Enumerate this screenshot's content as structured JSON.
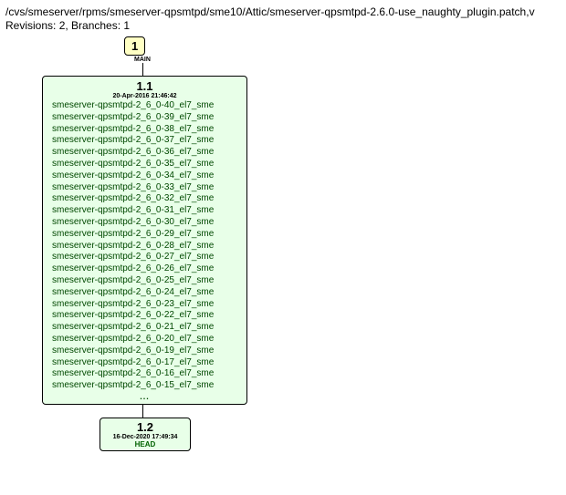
{
  "header": {
    "path": "/cvs/smeserver/rpms/smeserver-qpsmtpd/sme10/Attic/smeserver-qpsmtpd-2.6.0-use_naughty_plugin.patch,v",
    "revisions_line": "Revisions: 2, Branches: 1"
  },
  "branch_box": {
    "number": "1",
    "label": "MAIN"
  },
  "revision1": {
    "number": "1.1",
    "date": "20-Apr-2016 21:46:42",
    "tags": [
      "smeserver-qpsmtpd-2_6_0-40_el7_sme",
      "smeserver-qpsmtpd-2_6_0-39_el7_sme",
      "smeserver-qpsmtpd-2_6_0-38_el7_sme",
      "smeserver-qpsmtpd-2_6_0-37_el7_sme",
      "smeserver-qpsmtpd-2_6_0-36_el7_sme",
      "smeserver-qpsmtpd-2_6_0-35_el7_sme",
      "smeserver-qpsmtpd-2_6_0-34_el7_sme",
      "smeserver-qpsmtpd-2_6_0-33_el7_sme",
      "smeserver-qpsmtpd-2_6_0-32_el7_sme",
      "smeserver-qpsmtpd-2_6_0-31_el7_sme",
      "smeserver-qpsmtpd-2_6_0-30_el7_sme",
      "smeserver-qpsmtpd-2_6_0-29_el7_sme",
      "smeserver-qpsmtpd-2_6_0-28_el7_sme",
      "smeserver-qpsmtpd-2_6_0-27_el7_sme",
      "smeserver-qpsmtpd-2_6_0-26_el7_sme",
      "smeserver-qpsmtpd-2_6_0-25_el7_sme",
      "smeserver-qpsmtpd-2_6_0-24_el7_sme",
      "smeserver-qpsmtpd-2_6_0-23_el7_sme",
      "smeserver-qpsmtpd-2_6_0-22_el7_sme",
      "smeserver-qpsmtpd-2_6_0-21_el7_sme",
      "smeserver-qpsmtpd-2_6_0-20_el7_sme",
      "smeserver-qpsmtpd-2_6_0-19_el7_sme",
      "smeserver-qpsmtpd-2_6_0-17_el7_sme",
      "smeserver-qpsmtpd-2_6_0-16_el7_sme",
      "smeserver-qpsmtpd-2_6_0-15_el7_sme"
    ],
    "ellipsis": "..."
  },
  "revision2": {
    "number": "1.2",
    "date": "16-Dec-2020 17:49:34",
    "head": "HEAD"
  }
}
